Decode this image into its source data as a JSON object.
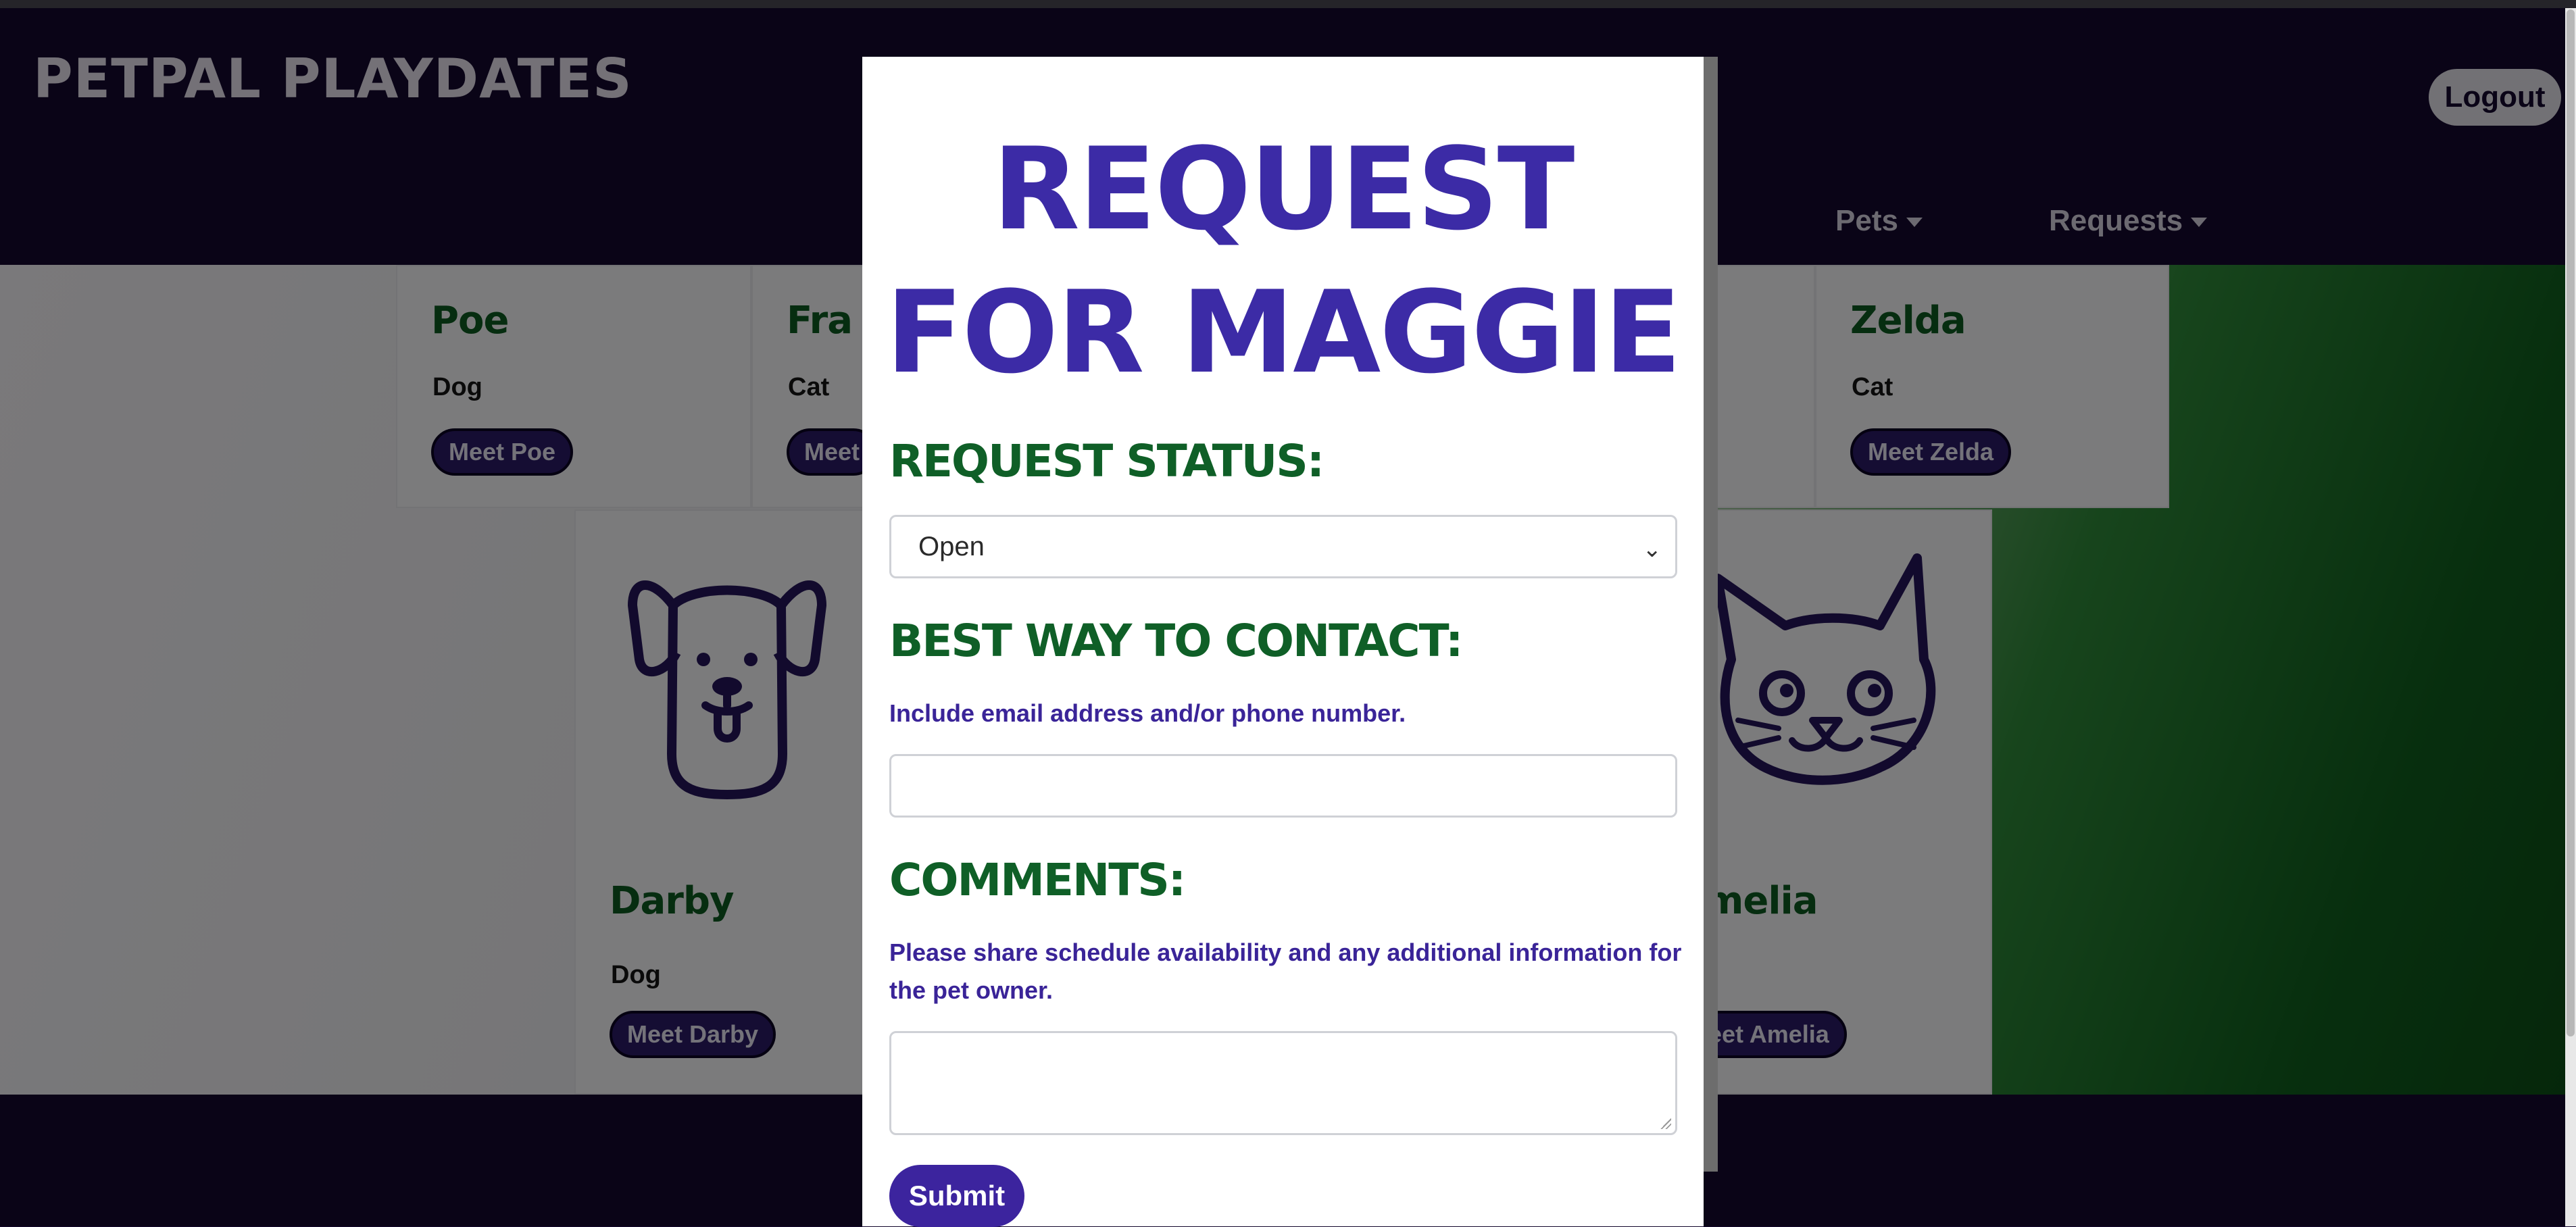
{
  "app": {
    "brand": "PetPal Playdates",
    "logout_label": "Logout"
  },
  "nav": {
    "items": [
      {
        "label": "Pets"
      },
      {
        "label": "Requests"
      }
    ]
  },
  "pets": [
    {
      "name": "Poe",
      "type": "Dog",
      "button": "Meet Poe"
    },
    {
      "name": "Fra",
      "type": "Cat",
      "button": "Meet"
    },
    {
      "name": "Zelda",
      "type": "Cat",
      "button": "Meet Zelda"
    },
    {
      "name": "Darby",
      "type": "Dog",
      "button": "Meet Darby",
      "icon": "dog-icon"
    },
    {
      "name": "melia",
      "button": "eet Amelia",
      "icon": "cat-icon"
    }
  ],
  "modal": {
    "title": "Request for Maggie",
    "status_heading": "Request Status:",
    "status_value": "Open",
    "contact_heading": "Best way to contact:",
    "contact_hint": "Include email address and/or phone number.",
    "contact_value": "",
    "comments_heading": "Comments:",
    "comments_hint": "Please share schedule availability and any additional information for the pet owner.",
    "comments_value": "",
    "submit_label": "Submit"
  },
  "colors": {
    "header": "#14082e",
    "accent": "#3c249e",
    "heading_green": "#0f5f27"
  }
}
